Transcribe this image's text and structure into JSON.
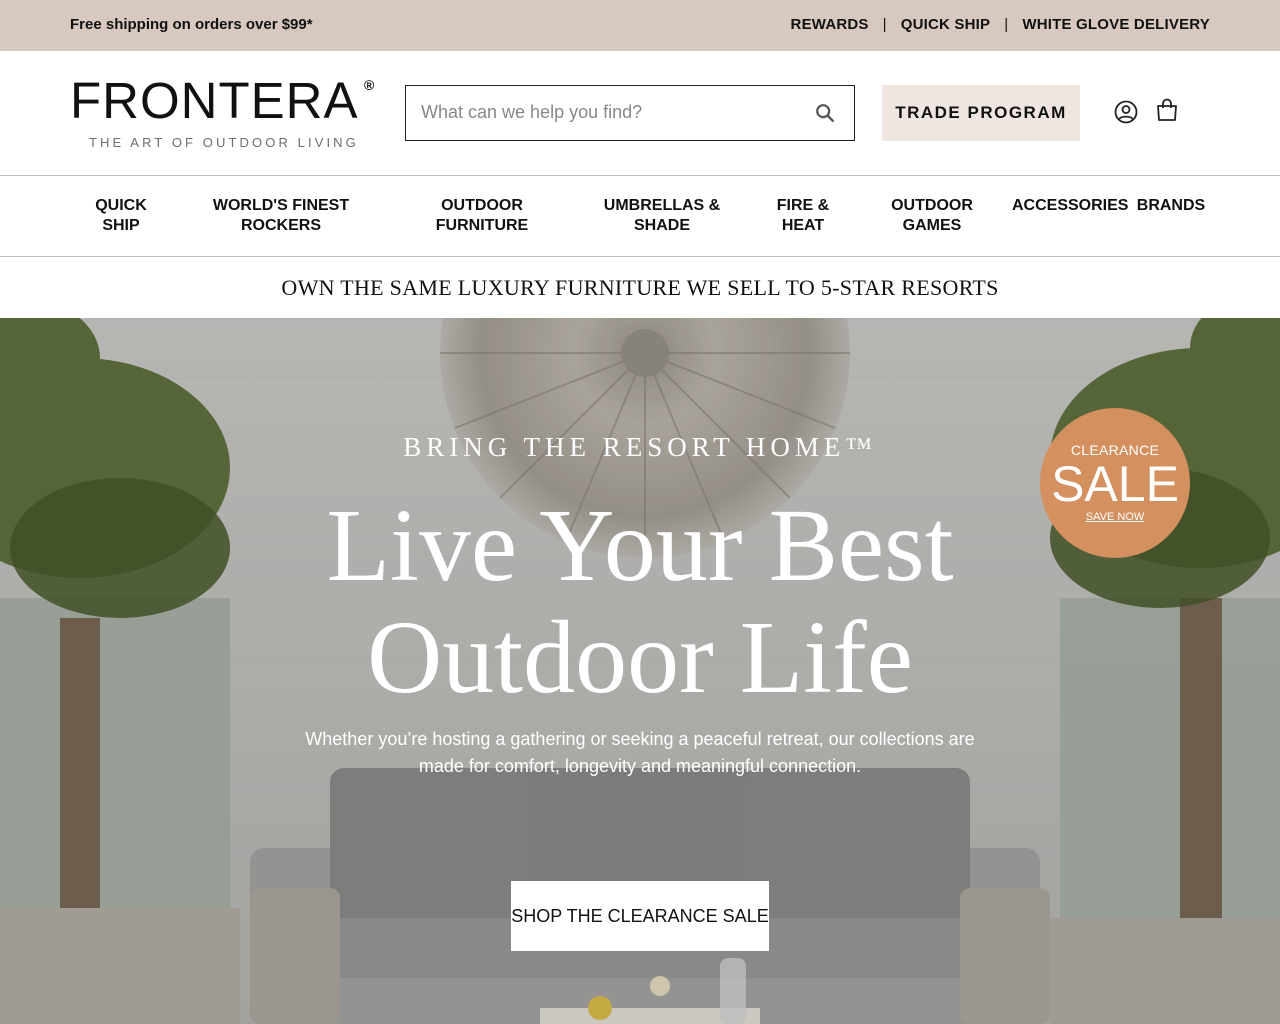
{
  "promo": {
    "shipping_text": "Free shipping on orders over $99*",
    "links": [
      "REWARDS",
      "QUICK SHIP",
      "WHITE GLOVE DELIVERY"
    ],
    "separator": "|"
  },
  "header": {
    "logo_text": "FRONTERA",
    "logo_mark": "®",
    "logo_tagline": "THE ART OF OUTDOOR LIVING",
    "search_placeholder": "What can we help you find?",
    "trade_label": "TRADE PROGRAM",
    "icons": [
      "search-icon",
      "account-icon",
      "cart-icon"
    ]
  },
  "nav": {
    "items": [
      "QUICK\nSHIP",
      "WORLD'S FINEST\nROCKERS",
      "OUTDOOR\nFURNITURE",
      "UMBRELLAS &\nSHADE",
      "FIRE &\nHEAT",
      "OUTDOOR\nGAMES",
      "ACCESSORIES",
      "BRANDS"
    ]
  },
  "announcement": "OWN THE SAME LUXURY FURNITURE WE SELL TO 5-STAR RESORTS",
  "hero": {
    "eyebrow": "BRING THE RESORT HOME™",
    "title_line1": "Live Your Best",
    "title_line2": "Outdoor Life",
    "subtitle": "Whether you’re hosting a gathering or seeking a peaceful retreat, our collections are made for comfort, longevity and meaningful connection.",
    "cta_label": "SHOP THE CLEARANCE SALE"
  },
  "sale_badge": {
    "small": "CLEARANCE",
    "big": "SALE",
    "link": "SAVE NOW",
    "color": "#d4905e"
  },
  "colors": {
    "promo_bg": "#d8c9c0",
    "trade_bg": "#efe5e1"
  }
}
